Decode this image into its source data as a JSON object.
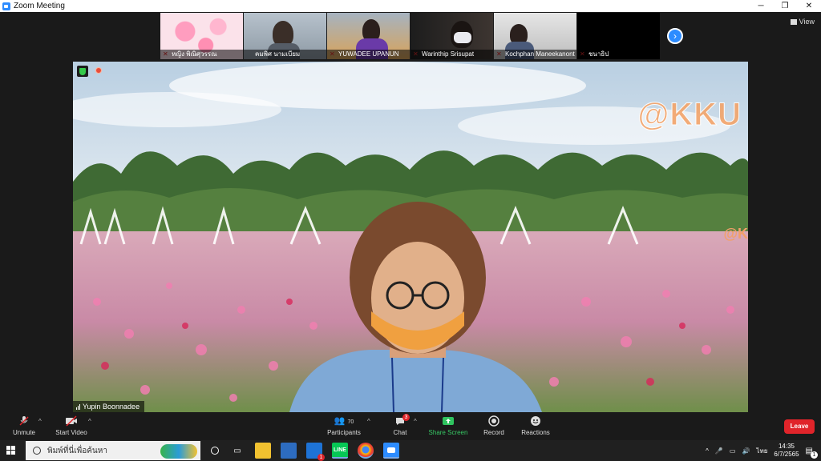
{
  "window": {
    "title": "Zoom Meeting",
    "controls": [
      "─",
      "❐",
      "✕"
    ]
  },
  "view_label": "View",
  "participants_strip": [
    {
      "name": "หญิง พิณิศุวรรณ",
      "muted": true
    },
    {
      "name": "คมพิศ นามเบียม",
      "muted": false
    },
    {
      "name": "YUWADEE UPANUN",
      "muted": true
    },
    {
      "name": "Warinthip Srisupat",
      "muted": true
    },
    {
      "name": "Kochphan Maneekanont",
      "muted": true
    },
    {
      "name": "ชนาธิป",
      "muted": true
    }
  ],
  "main_video": {
    "speaker_name": "Yupin Boonnadee",
    "watermark": "@KKU",
    "watermark_small": "@K"
  },
  "toolbar": {
    "unmute": "Unmute",
    "start_video": "Start Video",
    "participants": "Participants",
    "participants_count": "70",
    "chat": "Chat",
    "chat_badge": "3",
    "share_screen": "Share Screen",
    "record": "Record",
    "reactions": "Reactions",
    "leave": "Leave"
  },
  "taskbar": {
    "search_placeholder": "พิมพ์ที่นี่เพื่อค้นหา",
    "language": "ไทย",
    "time": "14:35",
    "date": "6/7/2565",
    "notification_count": "1",
    "mail_badge": "1"
  },
  "colors": {
    "zoom_blue": "#2d8cff",
    "leave_red": "#e0242a",
    "share_green": "#2fc35f",
    "toolbar_bg": "#1a1a1a",
    "taskbar_bg": "#202020"
  }
}
